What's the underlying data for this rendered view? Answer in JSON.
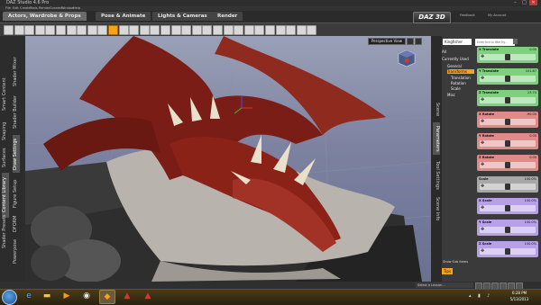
{
  "titlebar": {
    "title": "DAZ Studio 4.6 Pro",
    "minimize": "–",
    "maximize": "□",
    "close": "✕"
  },
  "menu": [
    "File",
    "Edit",
    "Create",
    "Tools",
    "Render",
    "Connect",
    "Window",
    "Help"
  ],
  "rooms": [
    "Actors, Wardrobe & Props",
    "Pose & Animate",
    "Lights & Cameras",
    "Render"
  ],
  "brand": {
    "logo": "DAZ 3D",
    "links": [
      "Feedback",
      "My Account"
    ]
  },
  "toolbar": {
    "tools": [
      "select-tool",
      "node-tool",
      "universal-tool",
      "rotate-tool",
      "translate-tool",
      "scale-tool",
      "camera-tool",
      "light-tool",
      "render-tool",
      "spot-render-tool",
      "geometry-tool",
      "pose-tool",
      "node-weight-tool",
      "joint-editor-tool",
      "surface-selection-tool",
      "region-tool",
      "active-pose-tool",
      "scene-tool",
      "figure-tool",
      "content-tool",
      "morph-tool",
      "dform-tool",
      "hair-tool",
      "props-tool",
      "shader-tool",
      "puppeteer-tool",
      "timeline-tool",
      "keyframe-tool",
      "script-tool",
      "extra-tool"
    ],
    "active_index": 10
  },
  "left_tabs": [
    "Smart Content",
    "Shaping",
    "Surfaces",
    "Content Library",
    "Shader Mixer",
    "Shader Builder",
    "Draw Settings",
    "Figure Setup",
    "Powerpose",
    "DFORM",
    "Shader Presets"
  ],
  "viewport": {
    "camera_label": "Perspective View",
    "accent": "#f4a41c"
  },
  "right_tabs": [
    "Scene",
    "Parameters",
    "Tool Settings",
    "Scene Info"
  ],
  "parameters": {
    "scope": "Kingfisher",
    "search_placeholder": "Enter text to filter by...",
    "tree": [
      "All",
      "Currently Used",
      "General",
      "Transforms",
      "Translation",
      "Rotation",
      "Scale",
      "Misc"
    ],
    "properties": [
      {
        "label": "X Translate",
        "value": "0.00",
        "color": "#7ed07e"
      },
      {
        "label": "Y Translate",
        "value": "101.67",
        "color": "#7ed07e"
      },
      {
        "label": "Z Translate",
        "value": "23.74",
        "color": "#7ed07e"
      },
      {
        "label": "X Rotate",
        "value": "-90.00",
        "color": "#e08a8a"
      },
      {
        "label": "Y Rotate",
        "value": "0.00",
        "color": "#e08a8a"
      },
      {
        "label": "Z Rotate",
        "value": "0.00",
        "color": "#e08a8a"
      },
      {
        "label": "Scale",
        "value": "100.0%",
        "color": "#a8a8a8"
      },
      {
        "label": "X Scale",
        "value": "100.0%",
        "color": "#b8a0e8"
      },
      {
        "label": "Y Scale",
        "value": "100.0%",
        "color": "#b8a0e8"
      },
      {
        "label": "Z Scale",
        "value": "100.0%",
        "color": "#b8a0e8"
      }
    ],
    "show_sub_items": "Show Sub Items",
    "tips": "Tips"
  },
  "statusbar": {
    "lesson": "Select a Lesson..."
  },
  "taskbar": {
    "apps": [
      "internet-explorer",
      "file-explorer",
      "media-player",
      "chrome",
      "daz-studio",
      "acrobat",
      "acrobat-2"
    ],
    "time": "6:28 PM",
    "date": "5/13/2013"
  }
}
